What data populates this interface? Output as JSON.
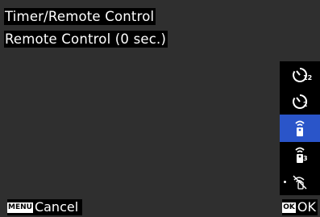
{
  "header": {
    "title": "Timer/Remote Control",
    "setting": "Remote Control (0 sec.)"
  },
  "modes": [
    {
      "icon": "self-timer-12s-icon",
      "subscript": "12",
      "selected": false
    },
    {
      "icon": "self-timer-2s-icon",
      "subscript": "2",
      "selected": false
    },
    {
      "icon": "remote-control-icon",
      "subscript": "",
      "selected": true
    },
    {
      "icon": "remote-control-3s-icon",
      "subscript": "3",
      "selected": false
    },
    {
      "icon": "remote-off-icon",
      "subscript": "",
      "selected": false
    }
  ],
  "footer": {
    "cancel_badge": "MENU",
    "cancel_label": "Cancel",
    "ok_badge": "OK",
    "ok_label": "OK"
  },
  "colors": {
    "background": "#2f2f2f",
    "selection": "#2a55c9"
  }
}
